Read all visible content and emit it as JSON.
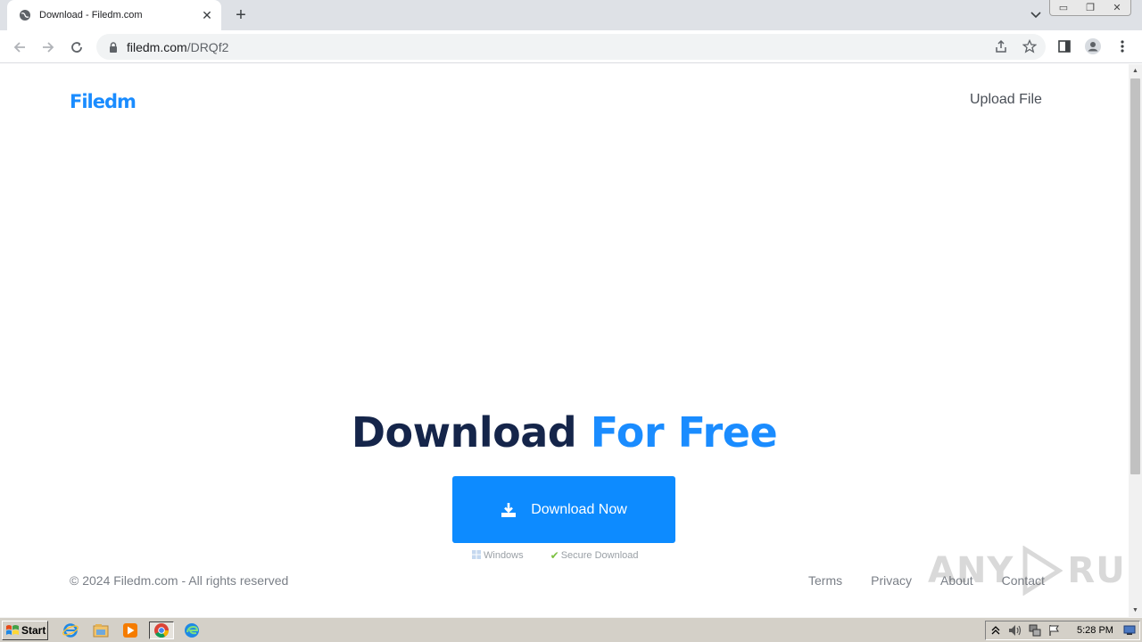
{
  "browser": {
    "tab": {
      "title": "Download - Filedm.com"
    },
    "address": {
      "host": "filedm.com",
      "path": "/DRQf2"
    }
  },
  "page": {
    "logo": "Filedm",
    "upload_link": "Upload File",
    "hero": {
      "title_part1": "Download",
      "title_part2": "For Free"
    },
    "download_button": {
      "label": "Download Now"
    },
    "badges": {
      "windows": "Windows",
      "secure": "Secure Download"
    },
    "footer": {
      "copyright": "© 2024 Filedm.com - All rights reserved",
      "links": [
        "Terms",
        "Privacy",
        "About",
        "Contact"
      ]
    },
    "colors": {
      "brand_blue": "#1a8cff",
      "heading_navy": "#15254a",
      "button_blue": "#0d8bff"
    }
  },
  "watermark": {
    "left": "ANY",
    "right": "RUN"
  },
  "taskbar": {
    "start_label": "Start",
    "clock": "5:28 PM",
    "pinned_icons": [
      "internet-explorer-icon",
      "file-explorer-icon",
      "media-player-icon",
      "chrome-icon",
      "edge-icon"
    ]
  }
}
